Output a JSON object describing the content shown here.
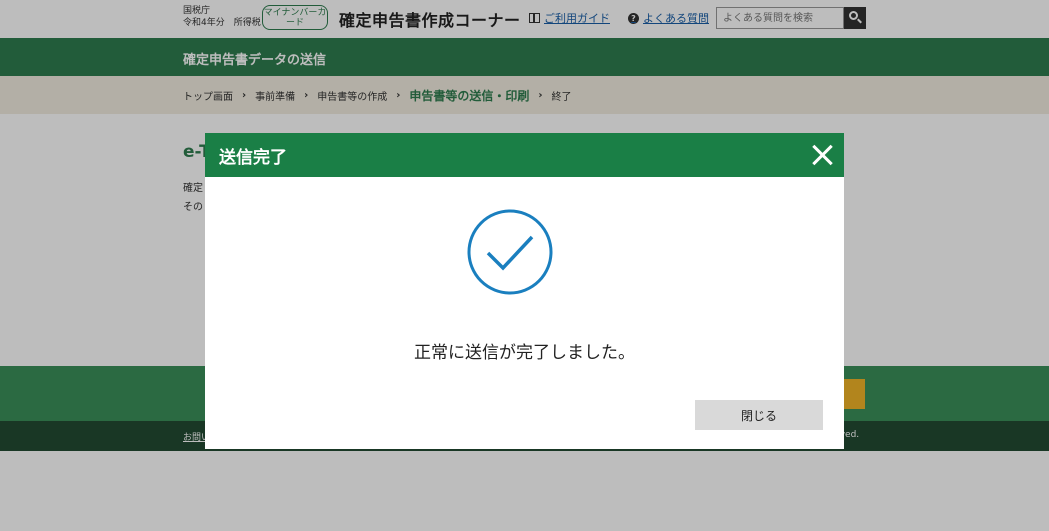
{
  "header": {
    "agency_line1": "国税庁",
    "agency_line2": "令和4年分　所得税",
    "mynumber_badge": "マイナンバーカード",
    "site_title": "確定申告書作成コーナー",
    "guide_link": "ご利用ガイド",
    "faq_link": "よくある質問",
    "search_placeholder": "よくある質問を検索"
  },
  "section_title": "確定申告書データの送信",
  "breadcrumb": [
    "トップ画面",
    "事前準備",
    "申告書等の作成",
    "申告書等の送信・印刷",
    "終了"
  ],
  "content": {
    "heading_partial": "e-T",
    "para1_partial": "確定",
    "para2_partial": "その"
  },
  "footer": {
    "link_partial": "お問い",
    "copyright_partial": "rved."
  },
  "modal": {
    "title": "送信完了",
    "message": "正常に送信が完了しました。",
    "close_button": "閉じる"
  },
  "colors": {
    "brand_green": "#2f7d4f",
    "modal_header_green": "#1a7f46",
    "check_blue": "#1a7fbf",
    "footer_yellow": "#f0b428"
  }
}
